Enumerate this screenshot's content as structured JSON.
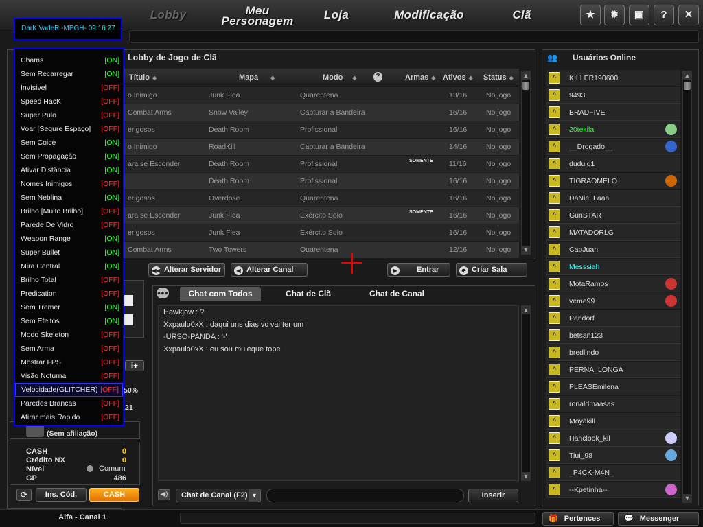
{
  "nav": {
    "lobby": "Lobby",
    "personagem_1": "Meu",
    "personagem_2": "Personagem",
    "loja": "Loja",
    "modificacao": "Modificação",
    "cla": "Clã",
    "icons": [
      "star-icon",
      "gear-icon",
      "lock-icon",
      "help-icon",
      "close-icon"
    ]
  },
  "cheat": {
    "title": "DarK VadeR -MPGH-",
    "time": "09:16:27",
    "items": [
      {
        "label": "Chams",
        "state": "[ON]"
      },
      {
        "label": "Sem Recarregar",
        "state": "[ON]"
      },
      {
        "label": "Invísivel",
        "state": "[OFF]"
      },
      {
        "label": "Speed HacK",
        "state": "[OFF]"
      },
      {
        "label": "Super Pulo",
        "state": "[OFF]"
      },
      {
        "label": "Voar [Segure Espaço]",
        "state": "[OFF]"
      },
      {
        "label": "Sem Coice",
        "state": "[ON]"
      },
      {
        "label": "Sem Propagação",
        "state": "[ON]"
      },
      {
        "label": "Ativar Distância",
        "state": "[ON]"
      },
      {
        "label": "Nomes Inimigos",
        "state": "[OFF]"
      },
      {
        "label": "Sem Neblina",
        "state": "[ON]"
      },
      {
        "label": "Brilho [Muito Brilho]",
        "state": "[OFF]"
      },
      {
        "label": "Parede De Vidro",
        "state": "[OFF]"
      },
      {
        "label": "Weapon Range",
        "state": "[ON]"
      },
      {
        "label": "Super Bullet",
        "state": "[ON]"
      },
      {
        "label": "Mira Central",
        "state": "[ON]"
      },
      {
        "label": "Brilho Total",
        "state": "[OFF]"
      },
      {
        "label": "Predication",
        "state": "[OFF]"
      },
      {
        "label": "Sem Tremer",
        "state": "[ON]"
      },
      {
        "label": "Sem Efeitos",
        "state": "[ON]"
      },
      {
        "label": "Modo Skeleton",
        "state": "[OFF]"
      },
      {
        "label": "Sem Arma",
        "state": "[OFF]"
      },
      {
        "label": "Mostrar FPS",
        "state": "[OFF]"
      },
      {
        "label": "Visão Noturna",
        "state": "[OFF]"
      },
      {
        "label": "Velocidade(GLITCHER)",
        "state": "[OFF]"
      },
      {
        "label": "Paredes Brancas",
        "state": "[OFF]"
      },
      {
        "label": "Atirar mais Rapido",
        "state": "[OFF]"
      }
    ]
  },
  "lobby": {
    "title": "Lobby de Jogo de Clã",
    "columns": {
      "titulo": "Título",
      "mapa": "Mapa",
      "modo": "Modo",
      "armas": "Armas",
      "ativos": "Ativos",
      "status": "Status"
    },
    "rows": [
      {
        "titulo": "o Inimigo",
        "mapa": "Junk Flea",
        "modo": "Quarentena",
        "armas": "",
        "ativos": "13/16",
        "status": "No jogo"
      },
      {
        "titulo": "Combat Arms",
        "mapa": "Snow Valley",
        "modo": "Capturar a Bandeira",
        "armas": "",
        "ativos": "16/16",
        "status": "No jogo"
      },
      {
        "titulo": "erigosos",
        "mapa": "Death Room",
        "modo": "Profissional",
        "armas": "",
        "ativos": "16/16",
        "status": "No jogo"
      },
      {
        "titulo": "o Inimigo",
        "mapa": "RoadKill",
        "modo": "Capturar a Bandeira",
        "armas": "",
        "ativos": "14/16",
        "status": "No jogo"
      },
      {
        "titulo": "ara se Esconder",
        "mapa": "Death Room",
        "modo": "Profissional",
        "armas": "SOMENTE",
        "ativos": "11/16",
        "status": "No jogo"
      },
      {
        "titulo": "",
        "mapa": "Death Room",
        "modo": "Profissional",
        "armas": "",
        "ativos": "16/16",
        "status": "No jogo"
      },
      {
        "titulo": "erigosos",
        "mapa": "Overdose",
        "modo": "Quarentena",
        "armas": "",
        "ativos": "16/16",
        "status": "No jogo"
      },
      {
        "titulo": "ara se Esconder",
        "mapa": "Junk Flea",
        "modo": "Exército Solo",
        "armas": "SOMENTE",
        "ativos": "16/16",
        "status": "No jogo"
      },
      {
        "titulo": "erigosos",
        "mapa": "Junk Flea",
        "modo": "Exército Solo",
        "armas": "",
        "ativos": "16/16",
        "status": "No jogo"
      },
      {
        "titulo": "Combat Arms",
        "mapa": "Two Towers",
        "modo": "Quarentena",
        "armas": "",
        "ativos": "12/16",
        "status": "No jogo"
      }
    ],
    "buttons": {
      "servidor": "Alterar Servidor",
      "canal": "Alterar Canal",
      "entrar": "Entrar",
      "criar": "Criar Sala"
    }
  },
  "chat": {
    "tabs": [
      "Chat com Todos",
      "Chat de Clã",
      "Chat de Canal"
    ],
    "lines": [
      "Hawkjow : ?",
      "Xxpaulo0xX : daqui uns dias vc vai ter um",
      "-URSO-PANDA : '-'",
      "Xxpaulo0xX : eu sou muleque tope"
    ],
    "channel_select": "Chat de Canal (F2)",
    "send": "Inserir"
  },
  "online": {
    "title": "Usuários Online",
    "users": [
      {
        "name": "KILLER190600",
        "color": "#ddd",
        "badge": ""
      },
      {
        "name": "9493",
        "color": "#ddd",
        "badge": ""
      },
      {
        "name": "BRADFIVE",
        "color": "#ddd",
        "badge": ""
      },
      {
        "name": "20tekila",
        "color": "#3f3",
        "badge": "clan"
      },
      {
        "name": "__Drogado__",
        "color": "#ddd",
        "badge": "clan"
      },
      {
        "name": "dudulg1",
        "color": "#ddd",
        "badge": ""
      },
      {
        "name": "TIGRAOMELO",
        "color": "#ddd",
        "badge": "clan"
      },
      {
        "name": "DaNieLLaaa",
        "color": "#ddd",
        "badge": ""
      },
      {
        "name": "GunSTAR",
        "color": "#ddd",
        "badge": ""
      },
      {
        "name": "MATADORLG",
        "color": "#ddd",
        "badge": ""
      },
      {
        "name": "CapJuan",
        "color": "#ddd",
        "badge": ""
      },
      {
        "name": "Messsiah",
        "color": "#3ff",
        "badge": ""
      },
      {
        "name": "MotaRamos",
        "color": "#ddd",
        "badge": "clan"
      },
      {
        "name": "veme99",
        "color": "#ddd",
        "badge": "clan"
      },
      {
        "name": "Pandorf",
        "color": "#ddd",
        "badge": ""
      },
      {
        "name": "betsan123",
        "color": "#ddd",
        "badge": ""
      },
      {
        "name": "bredlindo",
        "color": "#ddd",
        "badge": ""
      },
      {
        "name": "PERNA_LONGA",
        "color": "#ddd",
        "badge": ""
      },
      {
        "name": "PLEASEmilena",
        "color": "#ddd",
        "badge": ""
      },
      {
        "name": "ronaldmaasas",
        "color": "#ddd",
        "badge": ""
      },
      {
        "name": "Moyakill",
        "color": "#ddd",
        "badge": ""
      },
      {
        "name": "Hanclook_kil",
        "color": "#ddd",
        "badge": "clan"
      },
      {
        "name": "Tiui_98",
        "color": "#ddd",
        "badge": "clan"
      },
      {
        "name": "_P4CK-M4N_",
        "color": "#ddd",
        "badge": ""
      },
      {
        "name": "--Kpetinha--",
        "color": "#ddd",
        "badge": "clan"
      }
    ]
  },
  "player": {
    "affiliation": "(Sem afiliação)",
    "pct_fragment": "50%",
    "num_fragment": "21",
    "stats": {
      "cash_l": "CASH",
      "cash_v": "0",
      "nx_l": "Crédito NX",
      "nx_v": "0",
      "nivel_l": "Nível",
      "nivel_v": "Comum",
      "gp_l": "GP",
      "gp_v": "486"
    },
    "ins_cod": "Ins. Cód.",
    "cash_btn": "CASH"
  },
  "bottom": {
    "channel": "Alfa - Canal 1",
    "pertences": "Pertences",
    "messenger": "Messenger"
  }
}
